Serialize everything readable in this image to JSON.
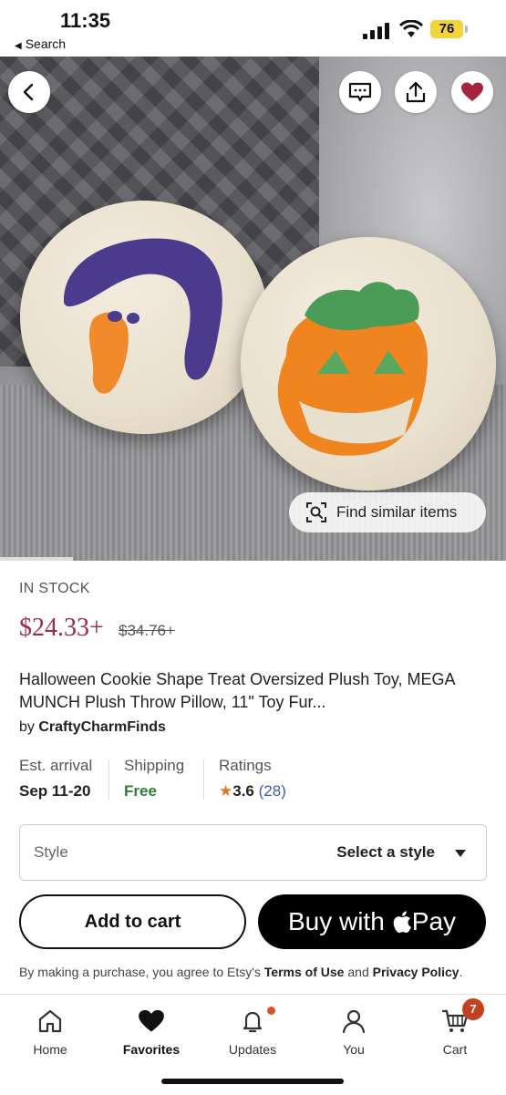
{
  "status_bar": {
    "time": "11:35",
    "back_app": "Search",
    "battery": "76"
  },
  "hero": {
    "find_similar_label": "Find similar items",
    "icons": [
      "back-arrow-icon",
      "message-icon",
      "share-icon",
      "heart-icon"
    ],
    "favorite_color": "#a3263e"
  },
  "product": {
    "stock": "IN STOCK",
    "price": "$24.33+",
    "old_price": "$34.76+",
    "title": "Halloween Cookie Shape Treat Oversized Plush Toy, MEGA MUNCH Plush Throw Pillow, 11\" Toy Fur...",
    "by_label": "by",
    "shop": "CraftyCharmFinds"
  },
  "meta": {
    "arrival_label": "Est. arrival",
    "arrival_value": "Sep 11-20",
    "shipping_label": "Shipping",
    "shipping_value": "Free",
    "ratings_label": "Ratings",
    "rating": "3.6",
    "rating_count": "(28)"
  },
  "style_select": {
    "label": "Style",
    "value": "Select a style"
  },
  "actions": {
    "add_to_cart": "Add to cart",
    "buy_with": "Buy with",
    "pay": "Pay"
  },
  "legal": {
    "prefix": "By making a purchase, you agree to Etsy's",
    "terms": "Terms of Use",
    "and": "and",
    "privacy": "Privacy Policy",
    "suffix": "."
  },
  "tabbar": {
    "items": [
      {
        "label": "Home",
        "icon": "home-icon"
      },
      {
        "label": "Favorites",
        "icon": "heart-icon"
      },
      {
        "label": "Updates",
        "icon": "bell-icon"
      },
      {
        "label": "You",
        "icon": "person-icon"
      },
      {
        "label": "Cart",
        "icon": "cart-icon"
      }
    ],
    "cart_count": "7",
    "active": "Favorites"
  },
  "colors": {
    "price": "#9e2a4a",
    "shipping_free": "#2e7d32",
    "rating_count": "#3b5bb5",
    "star": "#e07a1f",
    "badge": "#c5401e"
  }
}
